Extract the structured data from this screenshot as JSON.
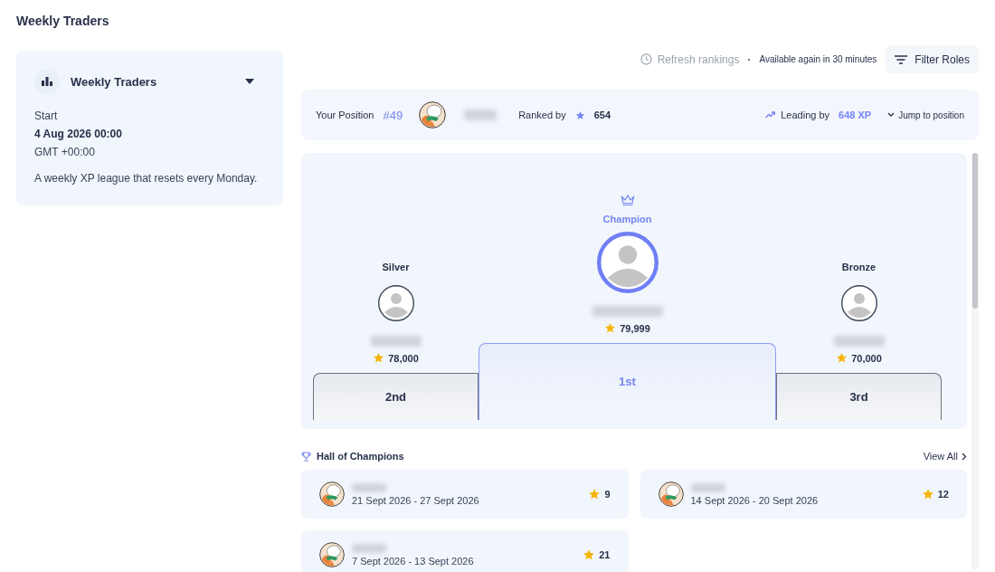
{
  "page_title": "Weekly Traders",
  "league": {
    "name": "Weekly Traders",
    "start_label": "Start",
    "start_date": "4 Aug 2026 00:00",
    "timezone": "GMT +00:00",
    "description": "A weekly XP league that resets every Monday."
  },
  "toolbar": {
    "refresh": {
      "label": "Refresh rankings",
      "disabled": true
    },
    "availability": "Available again in 30 minutes",
    "filter": "Filter Roles"
  },
  "position": {
    "label": "Your Position",
    "rank": "#49",
    "ranked_by_label": "Ranked by",
    "score": "654",
    "leading_label": "Leading by",
    "leading_value": "648 XP",
    "jump": "Jump to position"
  },
  "podium": {
    "champion_label": "Champion",
    "places": [
      {
        "kind": "silver",
        "title": "Silver",
        "score": "78,000",
        "step": "2nd"
      },
      {
        "kind": "champion",
        "score": "79,999",
        "step": "1st"
      },
      {
        "kind": "bronze",
        "title": "Bronze",
        "score": "70,000",
        "step": "3rd"
      }
    ]
  },
  "hall": {
    "title": "Hall of Champions",
    "view_all": "View All",
    "entries": [
      {
        "dates": "21 Sept 2026 - 27 Sept 2026",
        "score": "9"
      },
      {
        "dates": "14 Sept 2026 - 20 Sept 2026",
        "score": "12"
      },
      {
        "dates": "7 Sept 2026 - 13 Sept 2026",
        "score": "21"
      }
    ]
  }
}
